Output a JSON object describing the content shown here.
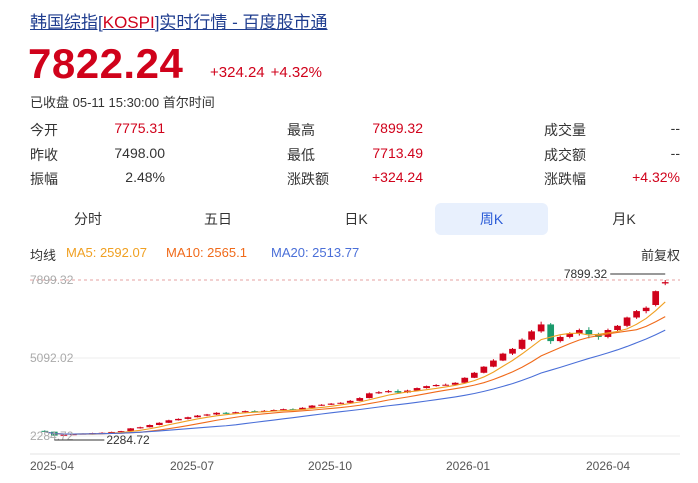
{
  "header": {
    "title_prefix": "韩国综指[",
    "title_code": "KOSPI",
    "title_suffix": "]实时行情 - 百度股市通",
    "price": "7822.24",
    "change": "+324.24",
    "change_pct": "+4.32%",
    "status": "已收盘 05-11 15:30:00 首尔时间"
  },
  "stats": {
    "open_label": "今开",
    "open_value": "7775.31",
    "high_label": "最高",
    "high_value": "7899.32",
    "volume_label": "成交量",
    "volume_value": "--",
    "prev_close_label": "昨收",
    "prev_close_value": "7498.00",
    "low_label": "最低",
    "low_value": "7713.49",
    "turnover_label": "成交额",
    "turnover_value": "--",
    "amplitude_label": "振幅",
    "amplitude_value": "2.48%",
    "change_amt_label": "涨跌额",
    "change_amt_value": "+324.24",
    "change_pct_label": "涨跌幅",
    "change_pct_value": "+4.32%"
  },
  "tabs": [
    "分时",
    "五日",
    "日K",
    "周K",
    "月K"
  ],
  "active_tab": "周K",
  "ma": {
    "label": "均线",
    "ma5": "MA5: 2592.07",
    "ma10": "MA10: 2565.1",
    "ma20": "MA20: 2513.77",
    "adjust": "前复权"
  },
  "colors": {
    "up": "#d0021b",
    "down": "#1a9a6c",
    "ma5": "#f0a022",
    "ma10": "#f06a1a",
    "ma20": "#4a6fd8",
    "accent": "#2a5bd7"
  },
  "chart_data": {
    "type": "candlestick",
    "y_labels": [
      "7899.32",
      "5092.02",
      "2284.72"
    ],
    "x_labels": [
      "2025-04",
      "2025-07",
      "2025-10",
      "2026-01",
      "2026-04"
    ],
    "max_annotation": "7899.32",
    "min_annotation": "2284.72",
    "ylim": [
      2284.72,
      7899.32
    ],
    "candles": [
      [
        2470,
        2440,
        2490,
        2420
      ],
      [
        2440,
        2300,
        2450,
        2284.72
      ],
      [
        2300,
        2330,
        2340,
        2290
      ],
      [
        2330,
        2350,
        2360,
        2320
      ],
      [
        2350,
        2370,
        2380,
        2340
      ],
      [
        2370,
        2390,
        2400,
        2360
      ],
      [
        2390,
        2400,
        2420,
        2380
      ],
      [
        2400,
        2430,
        2440,
        2390
      ],
      [
        2430,
        2460,
        2470,
        2420
      ],
      [
        2460,
        2560,
        2570,
        2450
      ],
      [
        2560,
        2600,
        2620,
        2550
      ],
      [
        2600,
        2680,
        2700,
        2590
      ],
      [
        2680,
        2760,
        2780,
        2670
      ],
      [
        2760,
        2850,
        2870,
        2750
      ],
      [
        2850,
        2900,
        2920,
        2840
      ],
      [
        2900,
        2960,
        2980,
        2880
      ],
      [
        2960,
        3020,
        3040,
        2950
      ],
      [
        3020,
        3060,
        3080,
        3000
      ],
      [
        3060,
        3120,
        3140,
        3040
      ],
      [
        3120,
        3100,
        3150,
        3080
      ],
      [
        3100,
        3140,
        3160,
        3090
      ],
      [
        3140,
        3180,
        3200,
        3130
      ],
      [
        3180,
        3170,
        3210,
        3150
      ],
      [
        3170,
        3190,
        3220,
        3160
      ],
      [
        3190,
        3220,
        3240,
        3180
      ],
      [
        3220,
        3250,
        3270,
        3210
      ],
      [
        3250,
        3230,
        3280,
        3220
      ],
      [
        3230,
        3300,
        3320,
        3220
      ],
      [
        3300,
        3380,
        3400,
        3290
      ],
      [
        3380,
        3410,
        3430,
        3370
      ],
      [
        3410,
        3450,
        3470,
        3400
      ],
      [
        3450,
        3480,
        3500,
        3440
      ],
      [
        3480,
        3550,
        3580,
        3470
      ],
      [
        3550,
        3650,
        3680,
        3540
      ],
      [
        3650,
        3820,
        3850,
        3640
      ],
      [
        3820,
        3860,
        3900,
        3800
      ],
      [
        3860,
        3900,
        3940,
        3840
      ],
      [
        3900,
        3850,
        3960,
        3830
      ],
      [
        3850,
        3920,
        3950,
        3830
      ],
      [
        3920,
        4010,
        4030,
        3900
      ],
      [
        4010,
        4080,
        4100,
        3990
      ],
      [
        4080,
        4120,
        4150,
        4060
      ],
      [
        4120,
        4130,
        4170,
        4100
      ],
      [
        4130,
        4200,
        4220,
        4120
      ],
      [
        4200,
        4380,
        4400,
        4190
      ],
      [
        4380,
        4560,
        4590,
        4370
      ],
      [
        4560,
        4780,
        4800,
        4540
      ],
      [
        4780,
        5000,
        5050,
        4760
      ],
      [
        5000,
        5250,
        5280,
        4980
      ],
      [
        5250,
        5420,
        5450,
        5200
      ],
      [
        5420,
        5750,
        5800,
        5380
      ],
      [
        5750,
        6050,
        6100,
        5700
      ],
      [
        6050,
        6300,
        6400,
        6000
      ],
      [
        6300,
        5700,
        6350,
        5600
      ],
      [
        5700,
        5850,
        5900,
        5650
      ],
      [
        5850,
        5980,
        6020,
        5800
      ],
      [
        5980,
        6100,
        6150,
        5900
      ],
      [
        6100,
        5950,
        6200,
        5800
      ],
      [
        5950,
        5850,
        6000,
        5750
      ],
      [
        5850,
        6100,
        6150,
        5800
      ],
      [
        6100,
        6250,
        6280,
        6050
      ],
      [
        6250,
        6550,
        6580,
        6200
      ],
      [
        6550,
        6780,
        6820,
        6500
      ],
      [
        6780,
        6900,
        6950,
        6700
      ],
      [
        7000,
        7498,
        7520,
        6950
      ],
      [
        7775.31,
        7822.24,
        7899.32,
        7713.49
      ]
    ]
  }
}
